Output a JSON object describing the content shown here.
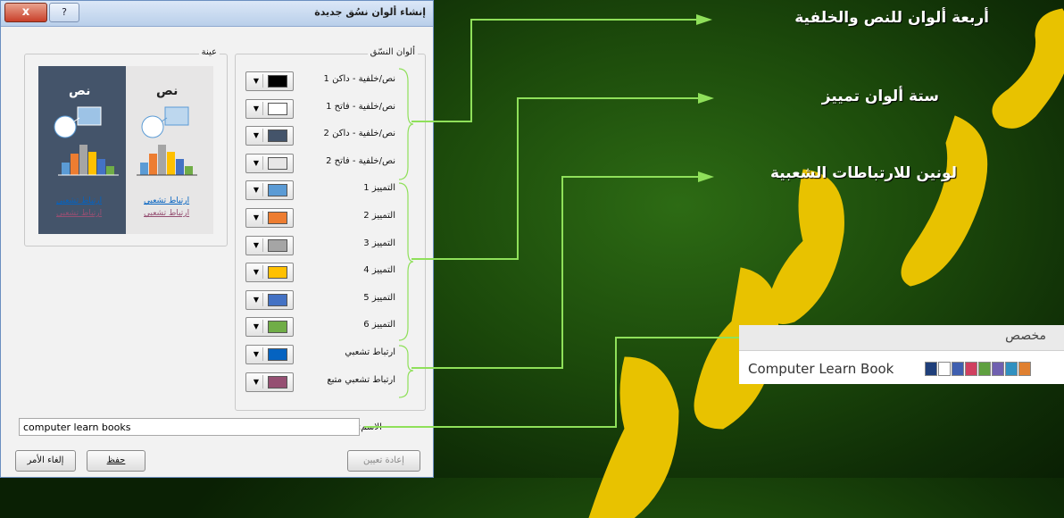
{
  "dialog": {
    "title": "إنشاء ألوان نسُق جديدة",
    "close_label": "x",
    "help_label": "?",
    "theme_colors_label": "ألوان النسّق",
    "sample_label": "عينة",
    "rows": [
      {
        "label": "نص/خلفية - داكن 1",
        "color": "#000000"
      },
      {
        "label": "نص/خلفية - فاتح 1",
        "color": "#ffffff"
      },
      {
        "label": "نص/خلفية - داكن 2",
        "color": "#44546a"
      },
      {
        "label": "نص/خلفية - فاتح 2",
        "color": "#e7e6e6"
      },
      {
        "label": "التمييز 1",
        "color": "#5b9bd5"
      },
      {
        "label": "التمييز 2",
        "color": "#ed7d31"
      },
      {
        "label": "التمييز 3",
        "color": "#a5a5a5"
      },
      {
        "label": "التمييز 4",
        "color": "#ffc000"
      },
      {
        "label": "التمييز 5",
        "color": "#4472c4"
      },
      {
        "label": "التمييز 6",
        "color": "#70ad47"
      },
      {
        "label": "ارتباط تشعبي",
        "color": "#0563c1"
      },
      {
        "label": "ارتباط تشعبي متبع",
        "color": "#954f72"
      }
    ],
    "sample": {
      "text_dark": "نص",
      "text_light": "نص",
      "link": "ارتباط تشعبي",
      "visited_link": "ارتباط تشعبي"
    },
    "name_label": "الاسم:",
    "name_value": "computer learn books",
    "reset_button": "إعادة تعيين",
    "save_button": "حفظ",
    "cancel_button": "إلغاء الأمر"
  },
  "annotations": {
    "text_bg": "أربعة ألوان للنص والخلفية",
    "accents": "ستة ألوان تمييز",
    "links": "لونين للارتباطات الشعبية"
  },
  "custom_panel": {
    "header": "مخصص",
    "theme_name": "Computer Learn Book",
    "swatches": [
      "#1f3f7a",
      "#ffffff",
      "#3f5fb0",
      "#d04060",
      "#5fa040",
      "#7060b0",
      "#3090c0",
      "#e08030"
    ]
  },
  "colors": {
    "arrow": "#8fe05a",
    "watermark": "#e8c200",
    "background": "#1c4a0b"
  }
}
